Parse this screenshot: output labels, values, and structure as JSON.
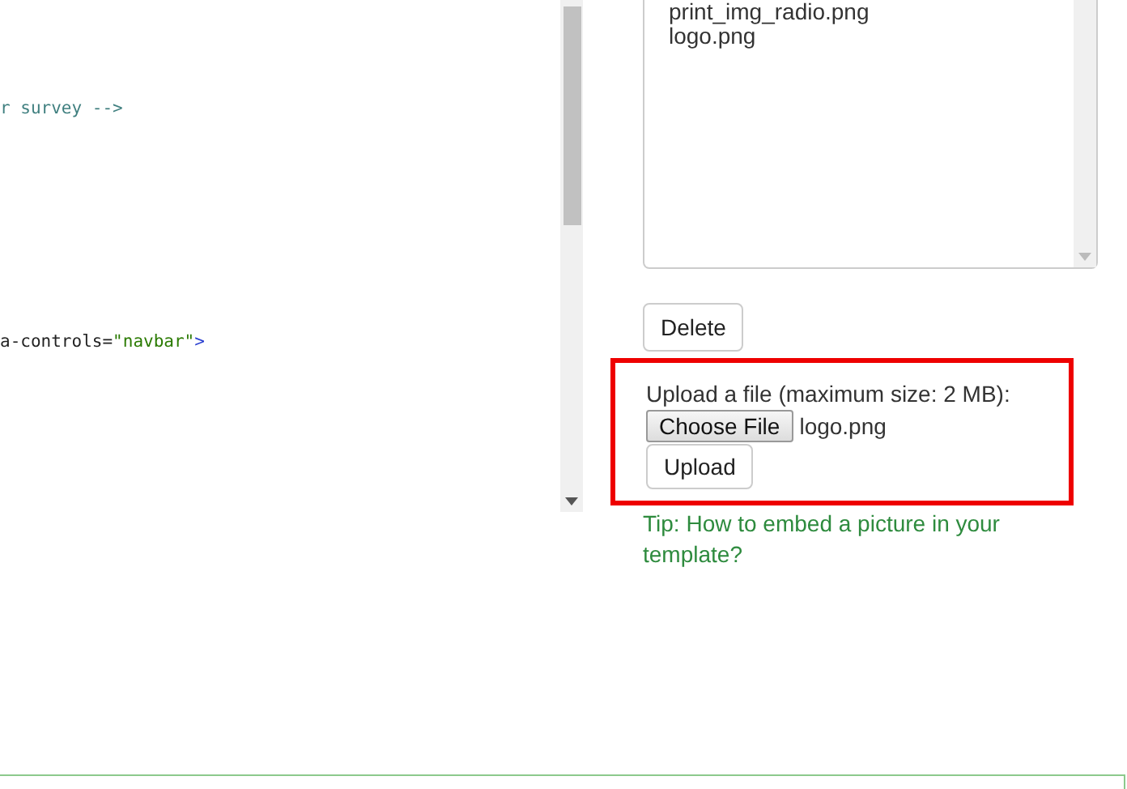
{
  "code_editor": {
    "lines": [
      {
        "kind": "comment",
        "parts": [
          {
            "kind": "comment",
            "text": "r survey -->"
          }
        ]
      },
      {
        "kind": "tag",
        "parts": [
          {
            "kind": "attr",
            "text": "a-controls="
          },
          {
            "kind": "value",
            "text": "\"navbar\""
          },
          {
            "kind": "bracket",
            "text": ">"
          }
        ]
      }
    ]
  },
  "file_list": {
    "items": [
      {
        "name": "print_img_radio.png",
        "selected": false
      },
      {
        "name": "logo.png",
        "selected": false
      }
    ]
  },
  "delete_button": "Delete",
  "upload": {
    "label": "Upload a file (maximum size: 2 MB):",
    "choose_button": "Choose File",
    "chosen_file": "logo.png",
    "upload_button": "Upload",
    "highlighted": true
  },
  "tip_link": "Tip: How to embed a picture in your template?"
}
